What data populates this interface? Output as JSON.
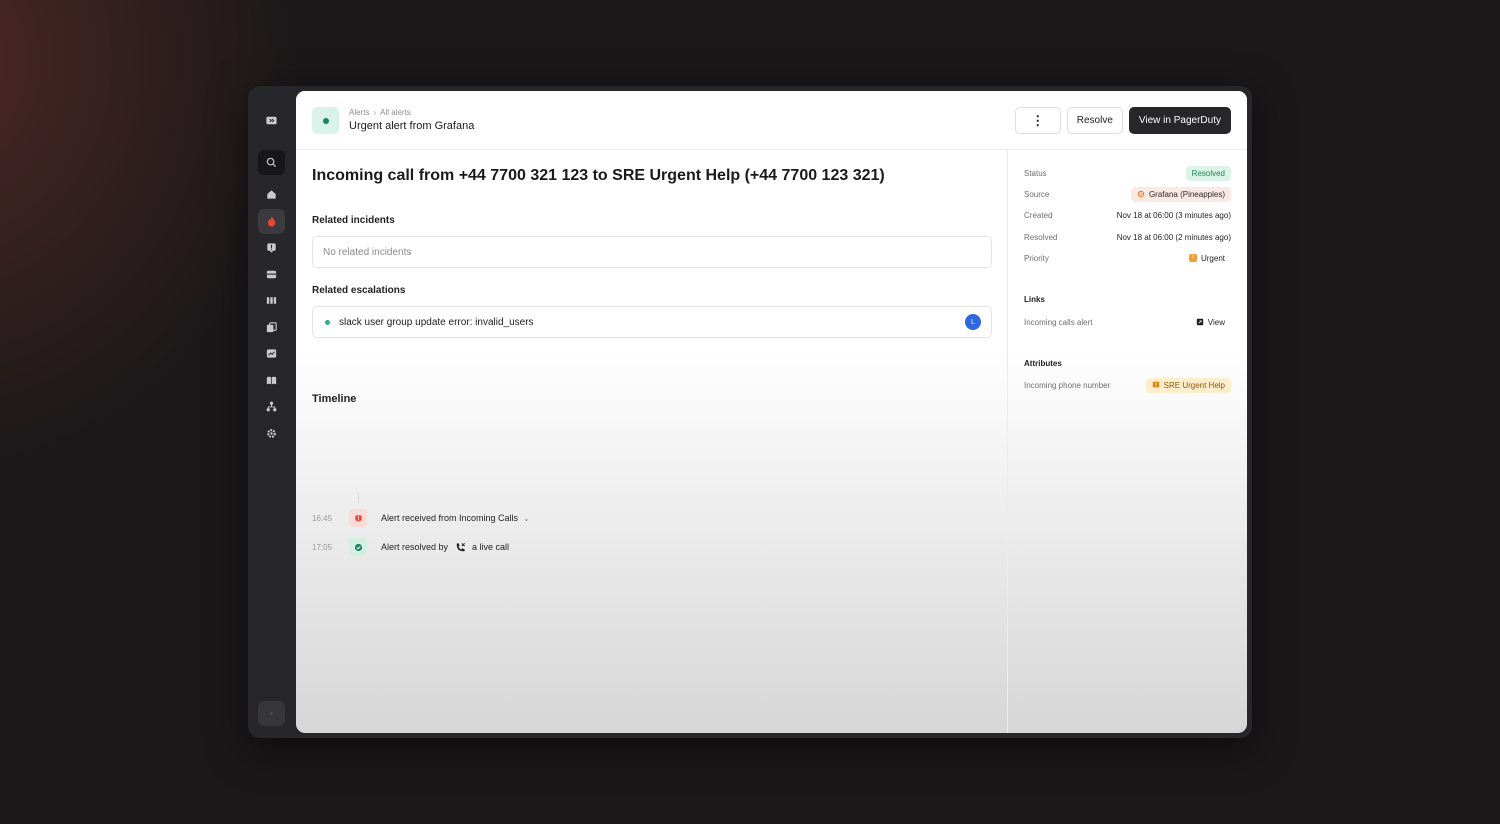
{
  "header": {
    "breadcrumb": [
      "Alerts",
      "All alerts"
    ],
    "title": "Urgent alert from Grafana",
    "more_label": "⋮",
    "resolve_label": "Resolve",
    "view_label": "View in PagerDuty"
  },
  "alert": {
    "title": "Incoming call from +44 7700 321 123 to SRE Urgent Help (+44 7700 123 321)"
  },
  "related_incidents": {
    "label": "Related incidents",
    "empty_text": "No related incidents"
  },
  "related_escalations": {
    "label": "Related escalations",
    "items": [
      {
        "text": "slack user group update error: invalid_users",
        "avatar": "L"
      }
    ]
  },
  "timeline": {
    "label": "Timeline",
    "events": [
      {
        "time": "16:45",
        "text": "Alert received from Incoming Calls",
        "icon": "alert-icon"
      },
      {
        "time": "17:05",
        "text": "Alert resolved by",
        "actor": "a live call",
        "icon": "check-icon"
      }
    ]
  },
  "details": {
    "status_label": "Status",
    "status_value": "Resolved",
    "source_label": "Source",
    "source_value": "Grafana (Pineapples)",
    "created_label": "Created",
    "created_value": "Nov 18 at 06:00 (3 minutes ago)",
    "resolved_label": "Resolved",
    "resolved_value": "Nov 18 at 06:00 (2 minutes ago)",
    "priority_label": "Priority",
    "priority_value": "Urgent"
  },
  "links": {
    "label": "Links",
    "items": [
      {
        "name": "Incoming calls alert",
        "action": "View"
      }
    ]
  },
  "attributes": {
    "label": "Attributes",
    "items": [
      {
        "name": "Incoming phone number",
        "value": "SRE Urgent Help"
      }
    ]
  },
  "colors": {
    "accent_green": "#15875e",
    "urgent_red": "#e5483b",
    "primary_button": "#27272a",
    "avatar_blue": "#2f67e0"
  },
  "sidebar_icons": [
    "collapse-icon",
    "search-icon",
    "home-icon",
    "incidents-icon",
    "alerts-icon",
    "inbox-icon",
    "board-icon",
    "copy-icon",
    "insights-icon",
    "catalog-icon",
    "org-icon",
    "settings-icon",
    "user-icon"
  ]
}
